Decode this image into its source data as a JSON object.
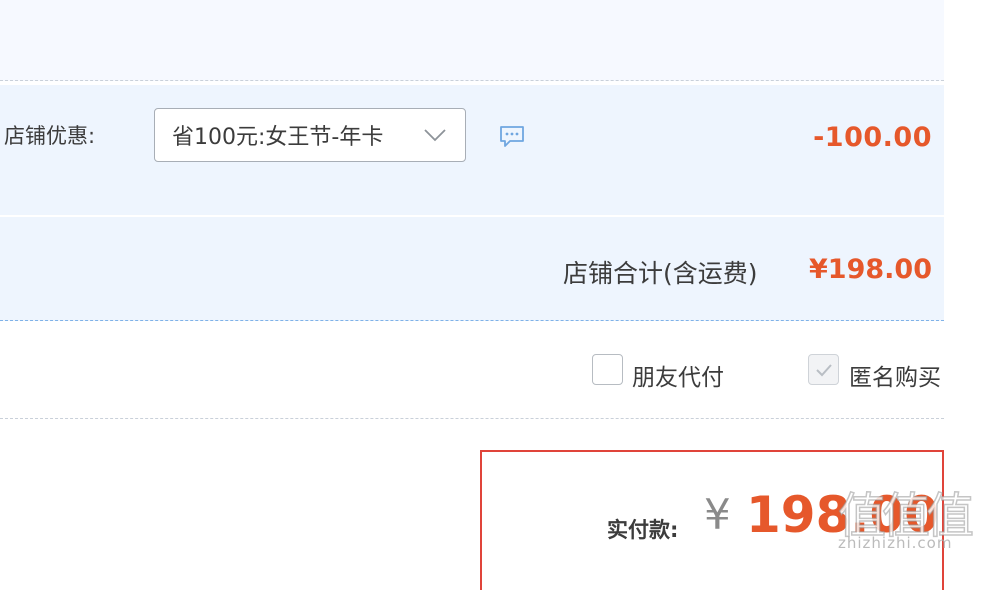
{
  "promo": {
    "label": "店铺优惠:",
    "selected": "省100元:女王节-年卡",
    "discount": "-100.00"
  },
  "total": {
    "label": "店铺合计(含运费)",
    "value": "¥198.00"
  },
  "options": {
    "friend_pay_label": "朋友代付",
    "friend_pay_checked": false,
    "anonymous_label": "匿名购买",
    "anonymous_checked": true
  },
  "payment": {
    "label": "实付款:",
    "currency": "¥",
    "amount": "198.00"
  },
  "watermark": {
    "glyphs": "值值值",
    "url": "zhizhizhi.com"
  },
  "colors": {
    "accent": "#e6582b",
    "pay_border": "#e0443a",
    "row_bg": "#eef5fe"
  }
}
